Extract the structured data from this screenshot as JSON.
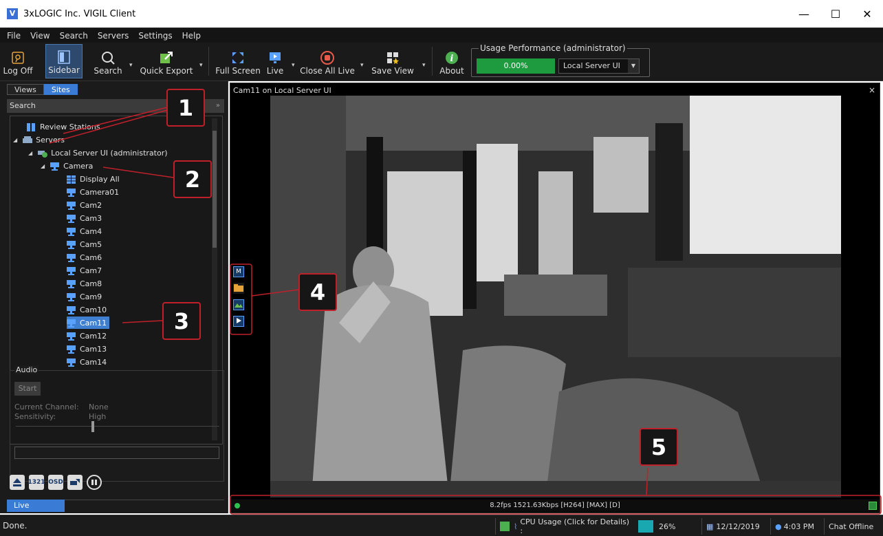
{
  "window": {
    "title": "3xLOGIC Inc. VIGIL Client",
    "app_icon": "V",
    "minimize": "—",
    "maximize": "☐",
    "close": "✕"
  },
  "menu": [
    "File",
    "View",
    "Search",
    "Servers",
    "Settings",
    "Help"
  ],
  "toolbar": {
    "log_off": "Log Off",
    "sidebar": "Sidebar",
    "search": "Search",
    "quick_export": "Quick Export",
    "full_screen": "Full Screen",
    "live": "Live",
    "close_all_live": "Close All Live",
    "save_view": "Save View",
    "about": "About",
    "usage_legend": "Usage Performance (administrator)",
    "usage_value": "0.00%",
    "server_select": "Local Server UI"
  },
  "sidebar": {
    "tabs": [
      "Views",
      "Sites"
    ],
    "active_tab": "Sites",
    "search_label": "Search",
    "tree": [
      {
        "label": "Review Stations"
      },
      {
        "label": "Servers"
      },
      {
        "label": "Local Server UI (administrator)"
      },
      {
        "label": "Camera"
      },
      {
        "label": "Display All"
      },
      {
        "label": "Camera01"
      },
      {
        "label": "Cam2"
      },
      {
        "label": "Cam3"
      },
      {
        "label": "Cam4"
      },
      {
        "label": "Cam5"
      },
      {
        "label": "Cam6"
      },
      {
        "label": "Cam7"
      },
      {
        "label": "Cam8"
      },
      {
        "label": "Cam9"
      },
      {
        "label": "Cam10"
      },
      {
        "label": "Cam11"
      },
      {
        "label": "Cam12"
      },
      {
        "label": "Cam13"
      },
      {
        "label": "Cam14"
      }
    ],
    "selected_item": "Cam11",
    "audio": {
      "legend": "Audio",
      "start": "Start",
      "current_channel_label": "Current Channel:",
      "current_channel_value": "None",
      "sensitivity_label": "Sensitivity:",
      "sensitivity_value": "High"
    },
    "controls": [
      "1321",
      "OSD"
    ],
    "live_tab": "Live"
  },
  "viewer": {
    "title": "Cam11 on Local Server UI",
    "close": "×",
    "stream_info": "8.2fps 1521.63Kbps [H264] [MAX] [D]",
    "side_icons": [
      "M"
    ]
  },
  "callouts": [
    "1",
    "2",
    "3",
    "4",
    "5"
  ],
  "status": {
    "left": "Done.",
    "cpu_label": "CPU Usage (Click for Details) :",
    "cpu_value": "26%",
    "date": "12/12/2019",
    "time": "4:03 PM",
    "chat": "Chat Offline"
  },
  "colors": {
    "accent": "#3a7bd5",
    "callout_border": "#c0202a",
    "usage_bar": "#1f9b3f"
  }
}
